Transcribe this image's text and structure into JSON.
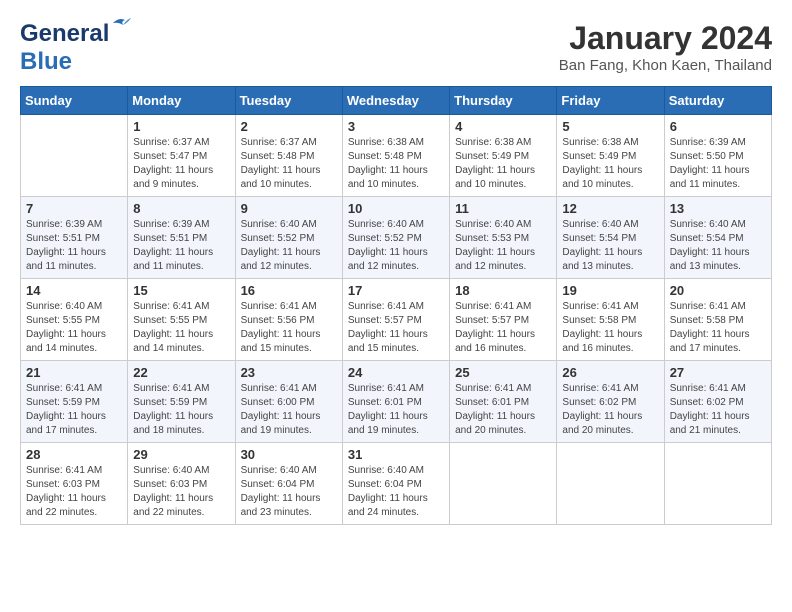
{
  "logo": {
    "line1": "General",
    "line2": "Blue"
  },
  "title": "January 2024",
  "subtitle": "Ban Fang, Khon Kaen, Thailand",
  "days_header": [
    "Sunday",
    "Monday",
    "Tuesday",
    "Wednesday",
    "Thursday",
    "Friday",
    "Saturday"
  ],
  "weeks": [
    [
      {
        "day": "",
        "info": ""
      },
      {
        "day": "1",
        "info": "Sunrise: 6:37 AM\nSunset: 5:47 PM\nDaylight: 11 hours\nand 9 minutes."
      },
      {
        "day": "2",
        "info": "Sunrise: 6:37 AM\nSunset: 5:48 PM\nDaylight: 11 hours\nand 10 minutes."
      },
      {
        "day": "3",
        "info": "Sunrise: 6:38 AM\nSunset: 5:48 PM\nDaylight: 11 hours\nand 10 minutes."
      },
      {
        "day": "4",
        "info": "Sunrise: 6:38 AM\nSunset: 5:49 PM\nDaylight: 11 hours\nand 10 minutes."
      },
      {
        "day": "5",
        "info": "Sunrise: 6:38 AM\nSunset: 5:49 PM\nDaylight: 11 hours\nand 10 minutes."
      },
      {
        "day": "6",
        "info": "Sunrise: 6:39 AM\nSunset: 5:50 PM\nDaylight: 11 hours\nand 11 minutes."
      }
    ],
    [
      {
        "day": "7",
        "info": "Sunrise: 6:39 AM\nSunset: 5:51 PM\nDaylight: 11 hours\nand 11 minutes."
      },
      {
        "day": "8",
        "info": "Sunrise: 6:39 AM\nSunset: 5:51 PM\nDaylight: 11 hours\nand 11 minutes."
      },
      {
        "day": "9",
        "info": "Sunrise: 6:40 AM\nSunset: 5:52 PM\nDaylight: 11 hours\nand 12 minutes."
      },
      {
        "day": "10",
        "info": "Sunrise: 6:40 AM\nSunset: 5:52 PM\nDaylight: 11 hours\nand 12 minutes."
      },
      {
        "day": "11",
        "info": "Sunrise: 6:40 AM\nSunset: 5:53 PM\nDaylight: 11 hours\nand 12 minutes."
      },
      {
        "day": "12",
        "info": "Sunrise: 6:40 AM\nSunset: 5:54 PM\nDaylight: 11 hours\nand 13 minutes."
      },
      {
        "day": "13",
        "info": "Sunrise: 6:40 AM\nSunset: 5:54 PM\nDaylight: 11 hours\nand 13 minutes."
      }
    ],
    [
      {
        "day": "14",
        "info": "Sunrise: 6:40 AM\nSunset: 5:55 PM\nDaylight: 11 hours\nand 14 minutes."
      },
      {
        "day": "15",
        "info": "Sunrise: 6:41 AM\nSunset: 5:55 PM\nDaylight: 11 hours\nand 14 minutes."
      },
      {
        "day": "16",
        "info": "Sunrise: 6:41 AM\nSunset: 5:56 PM\nDaylight: 11 hours\nand 15 minutes."
      },
      {
        "day": "17",
        "info": "Sunrise: 6:41 AM\nSunset: 5:57 PM\nDaylight: 11 hours\nand 15 minutes."
      },
      {
        "day": "18",
        "info": "Sunrise: 6:41 AM\nSunset: 5:57 PM\nDaylight: 11 hours\nand 16 minutes."
      },
      {
        "day": "19",
        "info": "Sunrise: 6:41 AM\nSunset: 5:58 PM\nDaylight: 11 hours\nand 16 minutes."
      },
      {
        "day": "20",
        "info": "Sunrise: 6:41 AM\nSunset: 5:58 PM\nDaylight: 11 hours\nand 17 minutes."
      }
    ],
    [
      {
        "day": "21",
        "info": "Sunrise: 6:41 AM\nSunset: 5:59 PM\nDaylight: 11 hours\nand 17 minutes."
      },
      {
        "day": "22",
        "info": "Sunrise: 6:41 AM\nSunset: 5:59 PM\nDaylight: 11 hours\nand 18 minutes."
      },
      {
        "day": "23",
        "info": "Sunrise: 6:41 AM\nSunset: 6:00 PM\nDaylight: 11 hours\nand 19 minutes."
      },
      {
        "day": "24",
        "info": "Sunrise: 6:41 AM\nSunset: 6:01 PM\nDaylight: 11 hours\nand 19 minutes."
      },
      {
        "day": "25",
        "info": "Sunrise: 6:41 AM\nSunset: 6:01 PM\nDaylight: 11 hours\nand 20 minutes."
      },
      {
        "day": "26",
        "info": "Sunrise: 6:41 AM\nSunset: 6:02 PM\nDaylight: 11 hours\nand 20 minutes."
      },
      {
        "day": "27",
        "info": "Sunrise: 6:41 AM\nSunset: 6:02 PM\nDaylight: 11 hours\nand 21 minutes."
      }
    ],
    [
      {
        "day": "28",
        "info": "Sunrise: 6:41 AM\nSunset: 6:03 PM\nDaylight: 11 hours\nand 22 minutes."
      },
      {
        "day": "29",
        "info": "Sunrise: 6:40 AM\nSunset: 6:03 PM\nDaylight: 11 hours\nand 22 minutes."
      },
      {
        "day": "30",
        "info": "Sunrise: 6:40 AM\nSunset: 6:04 PM\nDaylight: 11 hours\nand 23 minutes."
      },
      {
        "day": "31",
        "info": "Sunrise: 6:40 AM\nSunset: 6:04 PM\nDaylight: 11 hours\nand 24 minutes."
      },
      {
        "day": "",
        "info": ""
      },
      {
        "day": "",
        "info": ""
      },
      {
        "day": "",
        "info": ""
      }
    ]
  ]
}
